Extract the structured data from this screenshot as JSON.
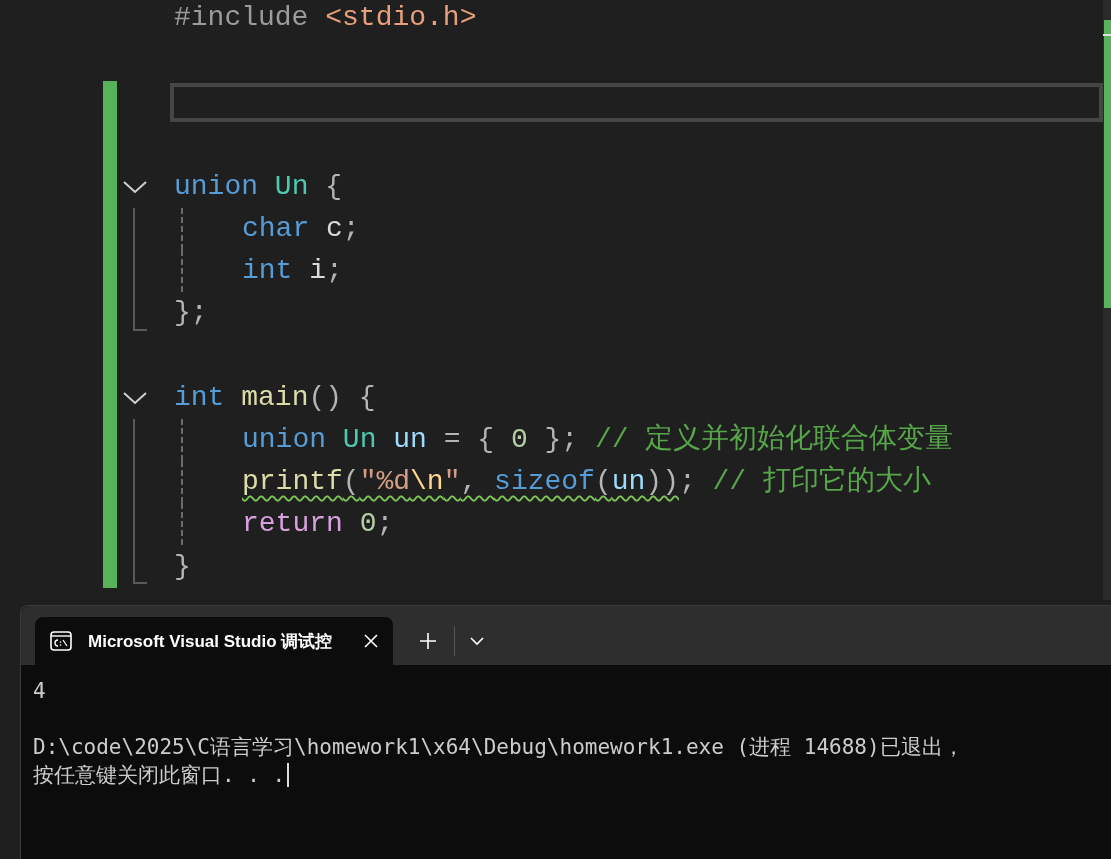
{
  "editor": {
    "lines": [
      {
        "changed": false,
        "tokens": [
          {
            "text": "#include ",
            "kind": "preprocessor"
          },
          {
            "text": "<stdio.h>",
            "kind": "header"
          }
        ]
      },
      {
        "changed": false
      },
      {
        "changed": true,
        "current": true
      },
      {
        "changed": true
      },
      {
        "changed": true,
        "expanded": true,
        "tokens": [
          {
            "text": "union ",
            "kind": "keyword"
          },
          {
            "text": "Un ",
            "kind": "type"
          },
          {
            "text": "{",
            "kind": "punct"
          }
        ],
        "children": [
          {
            "changed": true,
            "tokens": [
              {
                "text": "char ",
                "kind": "keyword"
              },
              {
                "text": "c",
                "kind": "local"
              },
              {
                "text": ";",
                "kind": "punct"
              }
            ]
          },
          {
            "changed": true,
            "tokens": [
              {
                "text": "int ",
                "kind": "keyword"
              },
              {
                "text": "i",
                "kind": "local"
              },
              {
                "text": ";",
                "kind": "punct"
              }
            ]
          }
        ],
        "closing": {
          "changed": true,
          "tokens": [
            {
              "text": "};",
              "kind": "punct"
            }
          ]
        }
      },
      {
        "changed": true
      },
      {
        "changed": true,
        "expanded": true,
        "tokens": [
          {
            "text": "int ",
            "kind": "keyword"
          },
          {
            "text": "main",
            "kind": "func"
          },
          {
            "text": "() {",
            "kind": "punct"
          }
        ],
        "children": [
          {
            "changed": true,
            "tokens": [
              {
                "text": "union ",
                "kind": "keyword"
              },
              {
                "text": "Un ",
                "kind": "type"
              },
              {
                "text": "un",
                "kind": "variable"
              },
              {
                "text": " = { ",
                "kind": "punct"
              },
              {
                "text": "0",
                "kind": "number"
              },
              {
                "text": " }; ",
                "kind": "punct"
              },
              {
                "text": "// 定义并初始化联合体变量",
                "kind": "comment"
              }
            ]
          },
          {
            "changed": true,
            "tokens": [
              {
                "text": "printf",
                "kind": "func",
                "warning": true
              },
              {
                "text": "(",
                "kind": "punct",
                "warning": true
              },
              {
                "text": "″%d",
                "kind": "string",
                "warning": true
              },
              {
                "text": "\\n",
                "kind": "escape",
                "warning": true
              },
              {
                "text": "″",
                "kind": "string",
                "warning": true
              },
              {
                "text": ", ",
                "kind": "punct",
                "warning": true
              },
              {
                "text": "sizeof",
                "kind": "keyword",
                "warning": true
              },
              {
                "text": "(",
                "kind": "punct",
                "warning": true
              },
              {
                "text": "un",
                "kind": "variable",
                "warning": true
              },
              {
                "text": "))",
                "kind": "punct",
                "warning": true
              },
              {
                "text": "; ",
                "kind": "punct"
              },
              {
                "text": "// 打印它的大小",
                "kind": "comment"
              }
            ]
          },
          {
            "changed": true,
            "tokens": [
              {
                "text": "return ",
                "kind": "control"
              },
              {
                "text": "0",
                "kind": "number"
              },
              {
                "text": ";",
                "kind": "punct"
              }
            ]
          }
        ],
        "closing": {
          "changed": true,
          "tokens": [
            {
              "text": "}",
              "kind": "punct"
            }
          ]
        }
      }
    ]
  },
  "terminal": {
    "tabs": [
      {
        "title": "Microsoft Visual Studio 调试控",
        "selected": true
      }
    ],
    "output": [
      {
        "lines": [
          "4"
        ]
      },
      {
        "lines": [
          "D:\\code\\2025\\C语言学习\\homework1\\x64\\Debug\\homework1.exe (进程 14688)已退出，",
          "按任意键关闭此窗口. . ."
        ]
      }
    ]
  }
}
